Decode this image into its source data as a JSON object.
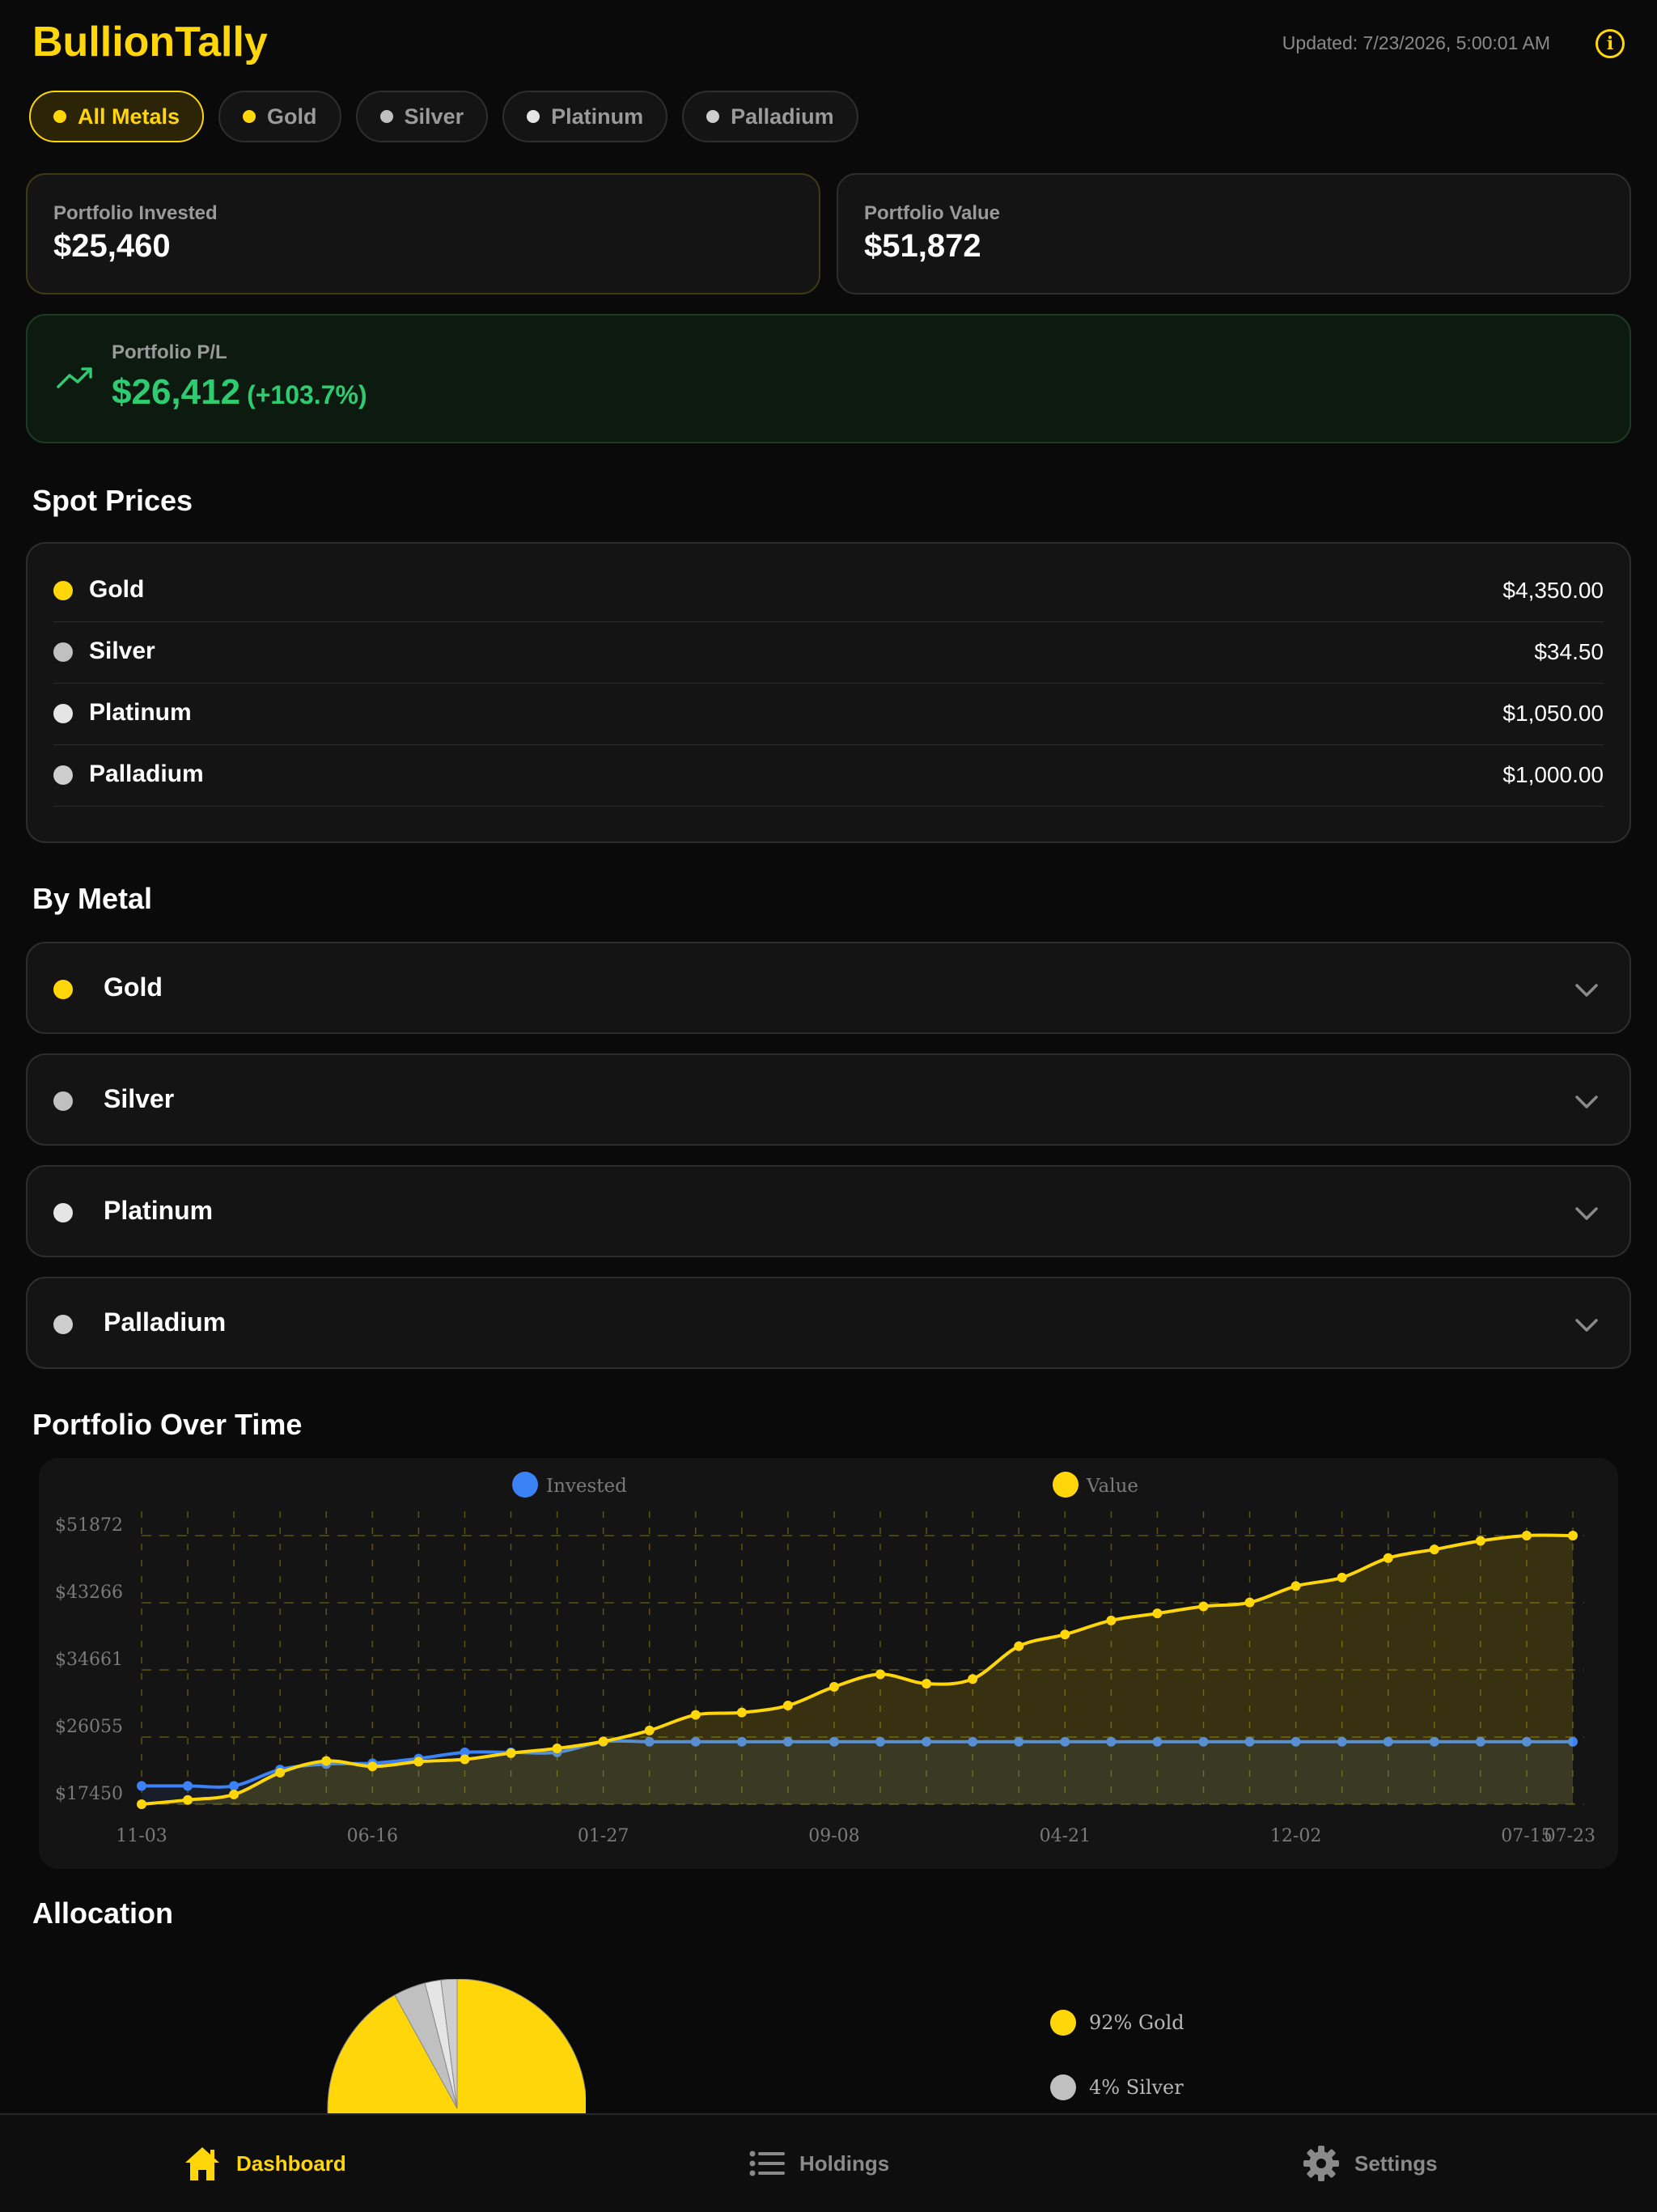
{
  "header": {
    "title": "BullionTally",
    "updated": "Updated: 7/23/2026, 5:00:01 AM"
  },
  "filters": [
    {
      "label": "All Metals",
      "color": "#ffd60a",
      "active": true
    },
    {
      "label": "Gold",
      "color": "#ffd60a",
      "active": false
    },
    {
      "label": "Silver",
      "color": "#c0c0c0",
      "active": false
    },
    {
      "label": "Platinum",
      "color": "#e5e5e5",
      "active": false
    },
    {
      "label": "Palladium",
      "color": "#cecece",
      "active": false
    }
  ],
  "summary": {
    "invested_label": "Portfolio Invested",
    "invested": "$25,460",
    "value_label": "Portfolio Value",
    "value": "$51,872",
    "pl_label": "Portfolio P/L",
    "pl": "$26,412",
    "pl_pct": "(+103.7%)"
  },
  "spot": {
    "title": "Spot Prices",
    "items": [
      {
        "name": "Gold",
        "price": "$4,350.00",
        "color": "#ffd60a"
      },
      {
        "name": "Silver",
        "price": "$34.50",
        "color": "#c0c0c0"
      },
      {
        "name": "Platinum",
        "price": "$1,050.00",
        "color": "#e5e5e5"
      },
      {
        "name": "Palladium",
        "price": "$1,000.00",
        "color": "#cecece"
      }
    ]
  },
  "by_metal": {
    "title": "By Metal",
    "items": [
      {
        "name": "Gold",
        "color": "#ffd60a"
      },
      {
        "name": "Silver",
        "color": "#c0c0c0"
      },
      {
        "name": "Platinum",
        "color": "#e5e5e5"
      },
      {
        "name": "Palladium",
        "color": "#cecece"
      }
    ]
  },
  "chart_section_title": "Portfolio Over Time",
  "chart_data": [
    {
      "type": "line",
      "title": "",
      "legend": [
        "Invested",
        "Value"
      ],
      "legend_position": "top",
      "grid": true,
      "y_ticks": [
        "$17450",
        "$26055",
        "$34661",
        "$43266",
        "$51872"
      ],
      "x_ticks": [
        "11-03",
        "06-16",
        "01-27",
        "09-08",
        "04-21",
        "12-02",
        "07-15",
        "07-23"
      ],
      "ylim": [
        17450,
        51872
      ],
      "series": [
        {
          "name": "Invested",
          "color": "#3b82f6",
          "values": [
            19800,
            19800,
            19800,
            21900,
            22600,
            22700,
            23300,
            24100,
            24100,
            24100,
            25460,
            25460,
            25460,
            25460,
            25460,
            25460,
            25460,
            25460,
            25460,
            25460,
            25460,
            25460,
            25460,
            25460,
            25460,
            25460,
            25460,
            25460,
            25460,
            25460,
            25460,
            25460
          ]
        },
        {
          "name": "Value",
          "color": "#ffd60a",
          "values": [
            17450,
            18000,
            18700,
            21500,
            23000,
            22300,
            22900,
            23200,
            24000,
            24600,
            25500,
            26900,
            28900,
            29200,
            30100,
            32500,
            34100,
            32900,
            33500,
            37700,
            39200,
            41000,
            41900,
            42800,
            43300,
            45400,
            46500,
            49000,
            50100,
            51200,
            51872,
            51872
          ]
        }
      ]
    },
    {
      "type": "pie",
      "title": "Allocation",
      "slices": [
        {
          "label": "Gold",
          "value": 92,
          "color": "#ffd60a"
        },
        {
          "label": "Silver",
          "value": 4,
          "color": "#c0c0c0"
        },
        {
          "label": "Platinum",
          "value": 2,
          "color": "#e5e5e5"
        },
        {
          "label": "Palladium",
          "value": 2,
          "color": "#cecece"
        }
      ],
      "visible_legend": [
        "92% Gold",
        "4% Silver"
      ]
    }
  ],
  "allocation_title": "Allocation",
  "tabs": [
    {
      "label": "Dashboard",
      "icon": "home-icon",
      "active": true
    },
    {
      "label": "Holdings",
      "icon": "list-icon",
      "active": false
    },
    {
      "label": "Settings",
      "icon": "gear-icon",
      "active": false
    }
  ]
}
